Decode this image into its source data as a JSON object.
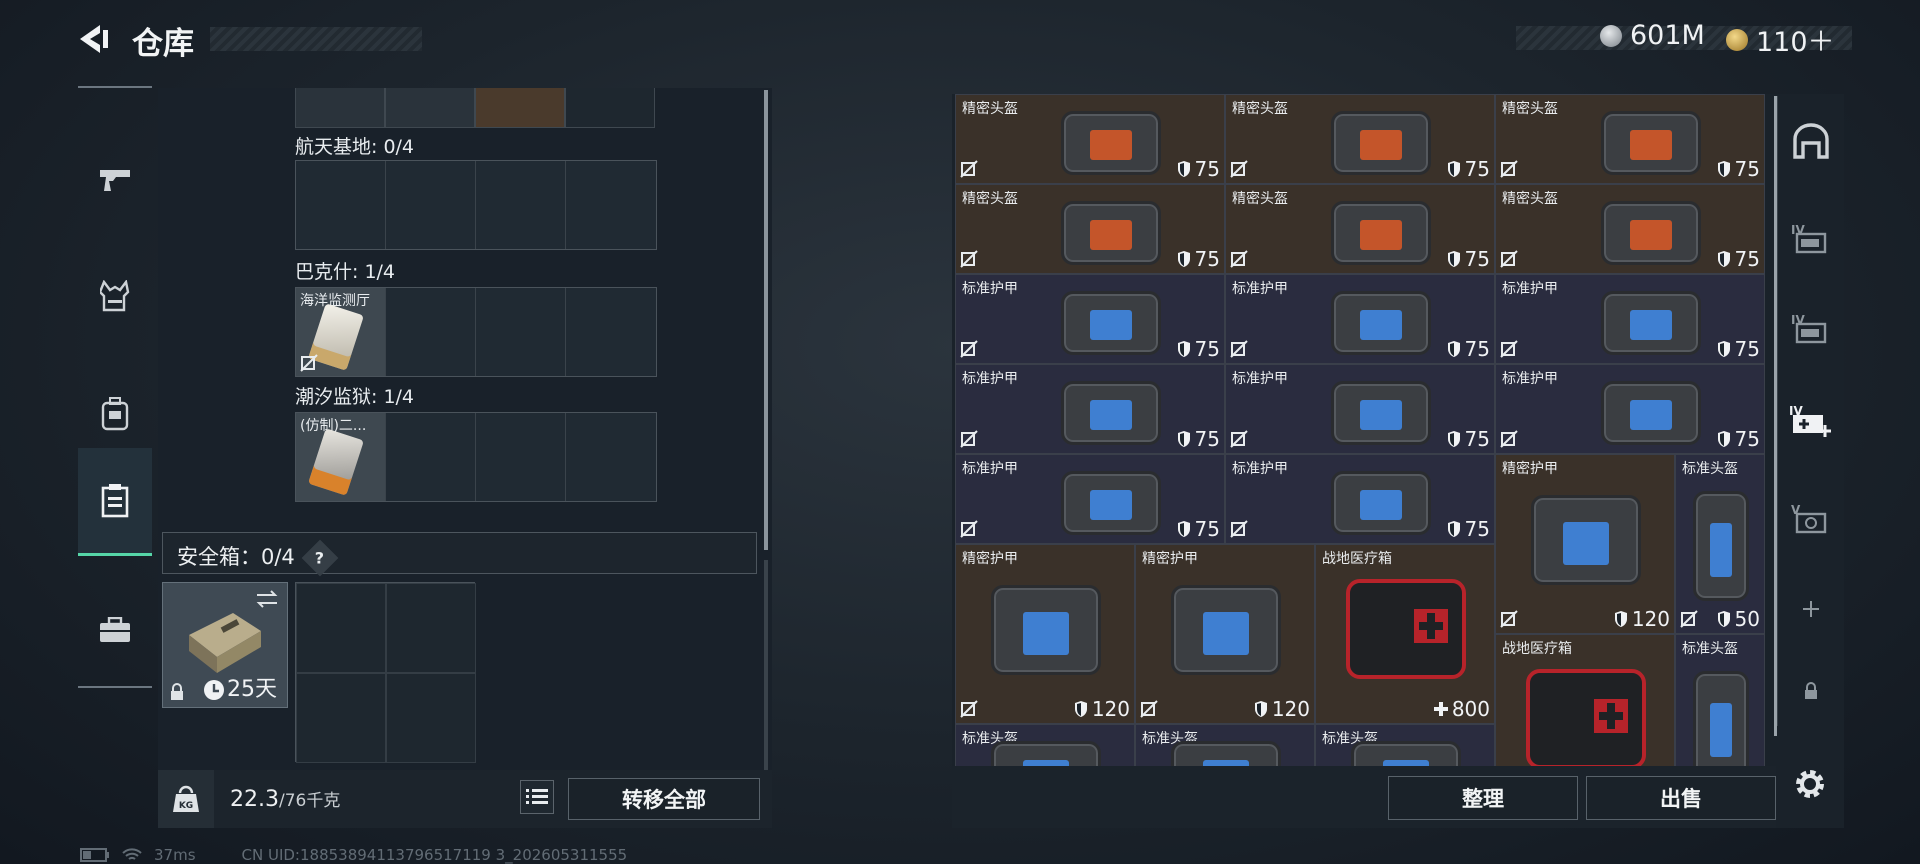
{
  "header": {
    "title": "仓库"
  },
  "currency": [
    {
      "icon": "silver-coin-icon",
      "value": "601M",
      "color": "#b8bec4"
    },
    {
      "icon": "triangle-coin-icon",
      "value": "110＋",
      "color": "#c9a24a"
    }
  ],
  "left_rail": [
    {
      "name": "rail-weapon",
      "icon": "pistol-icon"
    },
    {
      "name": "rail-vest",
      "icon": "vest-icon"
    },
    {
      "name": "rail-backpack",
      "icon": "backpack-icon"
    },
    {
      "name": "rail-container",
      "icon": "container-icon",
      "active": true
    },
    {
      "name": "rail-case",
      "icon": "briefcase-icon"
    }
  ],
  "sections": [
    {
      "label": "航天基地: 0/4",
      "items": []
    },
    {
      "label": "巴克什: 1/4",
      "items": [
        {
          "name": "海洋监测厅"
        }
      ]
    },
    {
      "label": "潮汐监狱: 1/4",
      "items": [
        {
          "name": "(仿制)二..."
        }
      ]
    }
  ],
  "safe_box": {
    "label": "安全箱：0/4",
    "help": "?",
    "timer": "25天"
  },
  "left_bottom": {
    "weight": "22.3",
    "weight_max": "/76千克",
    "transfer_all": "转移全部"
  },
  "items": [
    {
      "name": "精密头盔",
      "value": "75",
      "kind": "brown"
    },
    {
      "name": "精密头盔",
      "value": "75",
      "kind": "brown"
    },
    {
      "name": "精密头盔",
      "value": "75",
      "kind": "brown"
    },
    {
      "name": "精密头盔",
      "value": "75",
      "kind": "brown"
    },
    {
      "name": "精密头盔",
      "value": "75",
      "kind": "brown"
    },
    {
      "name": "精密头盔",
      "value": "75",
      "kind": "brown"
    },
    {
      "name": "标准护甲",
      "value": "75",
      "kind": "navy"
    },
    {
      "name": "标准护甲",
      "value": "75",
      "kind": "navy"
    },
    {
      "name": "标准护甲",
      "value": "75",
      "kind": "navy"
    },
    {
      "name": "标准护甲",
      "value": "75",
      "kind": "navy"
    },
    {
      "name": "标准护甲",
      "value": "75",
      "kind": "navy"
    },
    {
      "name": "标准护甲",
      "value": "75",
      "kind": "navy"
    },
    {
      "name": "标准护甲",
      "value": "75",
      "kind": "navy"
    },
    {
      "name": "标准护甲",
      "value": "75",
      "kind": "navy"
    },
    {
      "name": "精密护甲",
      "value": "120",
      "kind": "brown"
    },
    {
      "name": "标准头盔",
      "value": "50",
      "kind": "navy"
    },
    {
      "name": "精密护甲",
      "value": "120",
      "kind": "brown"
    },
    {
      "name": "精密护甲",
      "value": "120",
      "kind": "brown"
    },
    {
      "name": "战地医疗箱",
      "value": "800",
      "kind": "brown"
    },
    {
      "name": "战地医疗箱",
      "value": "",
      "kind": "brown"
    },
    {
      "name": "标准头盔",
      "value": "",
      "kind": "navy"
    },
    {
      "name": "标准头盔",
      "value": "",
      "kind": "navy"
    },
    {
      "name": "标准头盔",
      "value": "",
      "kind": "navy"
    },
    {
      "name": "标准头盔",
      "value": "",
      "kind": "navy"
    }
  ],
  "right_bottom": {
    "sort": "整理",
    "sell": "出售"
  },
  "right_rail": [
    "helmet-slot-icon",
    "folder-iv-icon",
    "folder-iv-icon",
    "add-iv-icon",
    "v-lock-icon",
    "plus-icon",
    "lock-icon"
  ],
  "status": {
    "ping": "37ms",
    "uid": "CN UID:18853894113796517119 3_202605311555"
  }
}
